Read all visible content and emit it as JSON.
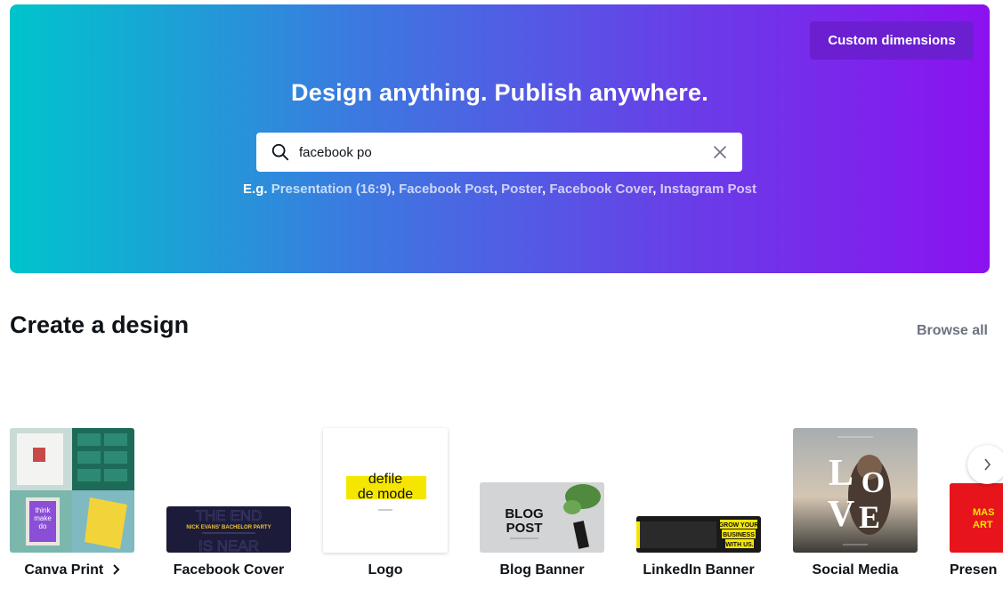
{
  "hero": {
    "custom_button": "Custom dimensions",
    "title": "Design anything. Publish anywhere.",
    "search_value": "facebook po",
    "examples_prefix": "E.g.",
    "suggestions": [
      "Presentation (16:9)",
      "Facebook Post",
      "Poster",
      "Facebook Cover",
      "Instagram Post"
    ]
  },
  "section": {
    "title": "Create a design",
    "browse_all": "Browse all"
  },
  "cards": [
    {
      "label": "Canva Print",
      "thumb_text": [
        "think",
        "make",
        "do"
      ]
    },
    {
      "label": "Facebook Cover",
      "thumb_text": [
        "THE END",
        "NICK EVANS' BACHELOR PARTY",
        "IS NEAR"
      ]
    },
    {
      "label": "Logo",
      "thumb_text": [
        "defile",
        "de mode"
      ]
    },
    {
      "label": "Blog Banner",
      "thumb_text": [
        "BLOG",
        "POST"
      ]
    },
    {
      "label": "LinkedIn Banner",
      "thumb_text": [
        "GROW YOUR",
        "BUSINESS",
        "WITH US."
      ]
    },
    {
      "label": "Social Media",
      "thumb_text": [
        "L",
        "O",
        "V",
        "E"
      ]
    },
    {
      "label": "Presen",
      "thumb_text": [
        "MAS",
        "ART"
      ]
    }
  ],
  "colors": {
    "gradient_start": "#00c4cc",
    "gradient_end": "#8b12f0",
    "custom_button_bg": "#6b1fd1"
  }
}
